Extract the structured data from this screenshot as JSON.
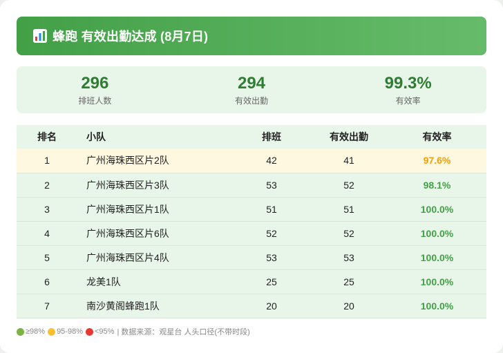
{
  "header": {
    "title": "蜂跑 有效出勤达成 (8月7日)",
    "accent_color": "#43a047"
  },
  "summary": [
    {
      "value": "296",
      "label": "排班人数"
    },
    {
      "value": "294",
      "label": "有效出勤"
    },
    {
      "value": "99.3%",
      "label": "有效率"
    }
  ],
  "table": {
    "columns": [
      "排名",
      "小队",
      "排班",
      "有效出勤",
      "有效率"
    ],
    "rows": [
      {
        "rank": "1",
        "team": "广州海珠西区片2队",
        "scheduled": "42",
        "valid": "41",
        "rate": "97.6%",
        "status": "yellow"
      },
      {
        "rank": "2",
        "team": "广州海珠西区片3队",
        "scheduled": "53",
        "valid": "52",
        "rate": "98.1%",
        "status": "green"
      },
      {
        "rank": "3",
        "team": "广州海珠西区片1队",
        "scheduled": "51",
        "valid": "51",
        "rate": "100.0%",
        "status": "green"
      },
      {
        "rank": "4",
        "team": "广州海珠西区片6队",
        "scheduled": "52",
        "valid": "52",
        "rate": "100.0%",
        "status": "green"
      },
      {
        "rank": "5",
        "team": "广州海珠西区片4队",
        "scheduled": "53",
        "valid": "53",
        "rate": "100.0%",
        "status": "green"
      },
      {
        "rank": "6",
        "team": "龙美1队",
        "scheduled": "25",
        "valid": "25",
        "rate": "100.0%",
        "status": "green"
      },
      {
        "rank": "7",
        "team": "南沙黄阁蜂跑1队",
        "scheduled": "20",
        "valid": "20",
        "rate": "100.0%",
        "status": "green"
      }
    ]
  },
  "footer": {
    "legend_green": "≥98%",
    "legend_yellow": "95-98%",
    "legend_red": "<95%",
    "source": "| 数据来源：观星台 人头口径(不带时段)",
    "colors": {
      "green": "#7cb342",
      "yellow": "#fbc02d",
      "red": "#e53935"
    }
  }
}
